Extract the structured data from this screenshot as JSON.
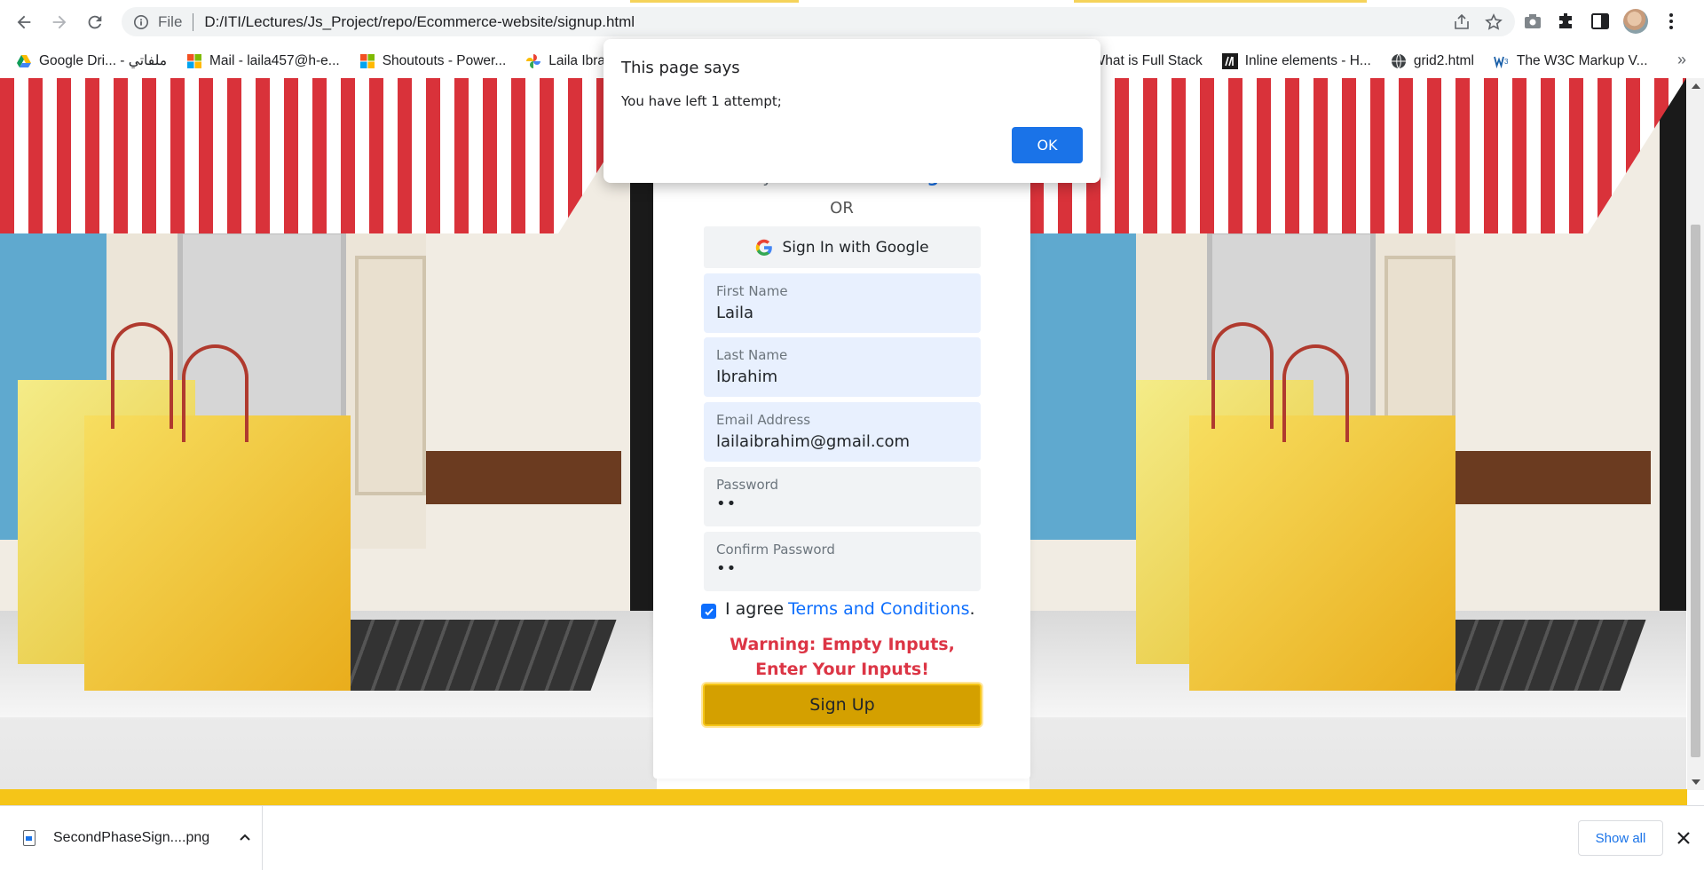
{
  "browser": {
    "file_label": "File",
    "url": "D:/ITI/Lectures/Js_Project/repo/Ecommerce-website/signup.html"
  },
  "bookmarks": [
    {
      "label": "Google Dri... - ملفاتي",
      "icon": "google-drive-icon"
    },
    {
      "label": "Mail - laila457@h-e...",
      "icon": "microsoft-icon"
    },
    {
      "label": "Shoutouts - Power...",
      "icon": "microsoft-icon"
    },
    {
      "label": "Laila Ibrah",
      "icon": "google-photos-icon"
    },
    {
      "label": "What is Full Stack",
      "icon": "blank-icon"
    },
    {
      "label": "Inline elements - H...",
      "icon": "mdn-icon"
    },
    {
      "label": "grid2.html",
      "icon": "globe-icon"
    },
    {
      "label": "The W3C Markup V...",
      "icon": "w3c-icon"
    }
  ],
  "bookmarks_more": "»",
  "signup": {
    "already_text": "Already Have Account?",
    "sign_in_link": "Sign In",
    "or_text": "OR",
    "google_button": "Sign In with Google",
    "fields": [
      {
        "label": "First Name",
        "value": "Laila"
      },
      {
        "label": "Last Name",
        "value": "Ibrahim"
      },
      {
        "label": "Email Address",
        "value": "lailaibrahim@gmail.com"
      },
      {
        "label": "Password",
        "value": "••"
      },
      {
        "label": "Confirm Password",
        "value": "••"
      }
    ],
    "agree_text": "I agree",
    "terms_link": "Terms and Conditions",
    "terms_period": ".",
    "agree_checked": true,
    "warning": "Warning: Empty Inputs, Enter Your Inputs!",
    "signup_button": "Sign Up"
  },
  "dialog": {
    "title": "This page says",
    "message": "You have left 1 attempt;",
    "ok_button": "OK"
  },
  "downloads": {
    "file_name": "SecondPhaseSign....png",
    "show_all": "Show all"
  },
  "colors": {
    "accent": "#1a73e8",
    "signup_button": "#d4a000",
    "warning": "#dc3545",
    "footer_strip": "#f5c518"
  }
}
